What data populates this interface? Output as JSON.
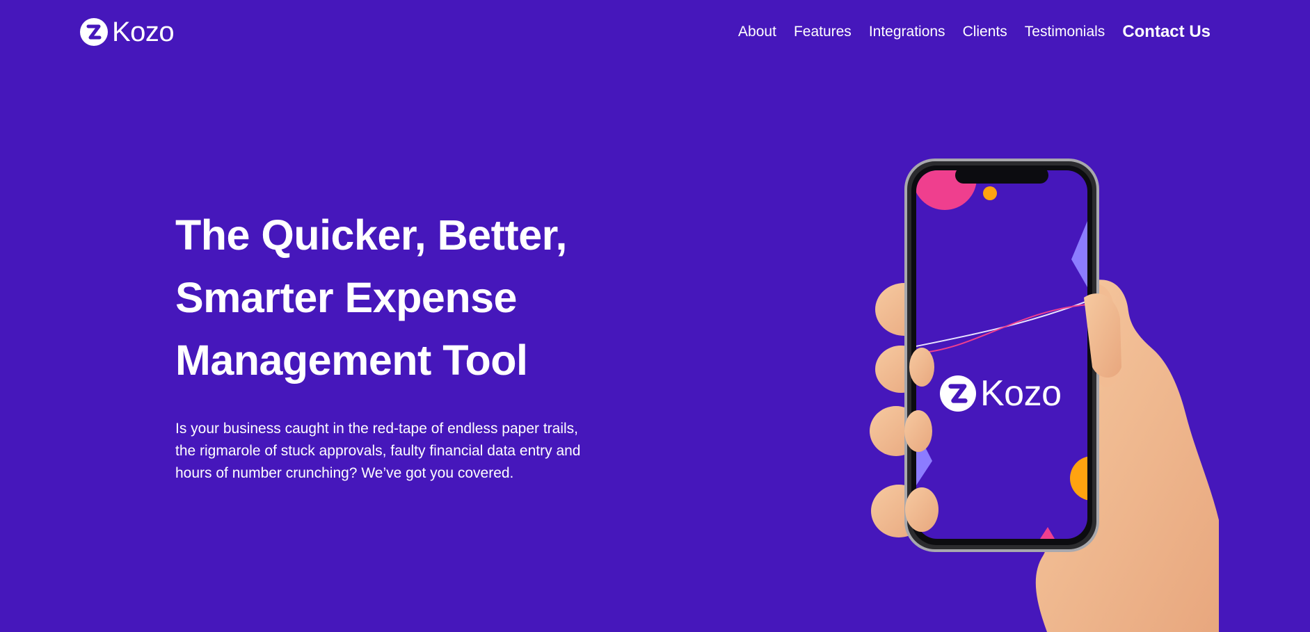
{
  "brand": {
    "name": "Kozo",
    "colors": {
      "background": "#4617bb",
      "text": "#ffffff",
      "accent_pink": "#ef3f8e",
      "accent_orange": "#ffa310",
      "accent_lilac": "#8c7cff"
    }
  },
  "nav": {
    "items": [
      "About",
      "Features",
      "Integrations",
      "Clients",
      "Testimonials"
    ],
    "contact_label": "Contact Us"
  },
  "hero": {
    "title": "The Quicker, Better, Smarter Expense Management Tool",
    "description": "Is your business caught in the red-tape of endless paper trails, the rigmarole of stuck approvals, faulty financial data entry and hours of number crunching? We’ve got you covered."
  },
  "illustration": {
    "phone_logo_text": "Kozo",
    "icons": [
      "kozo-logo-icon",
      "hand-holding-phone"
    ]
  }
}
